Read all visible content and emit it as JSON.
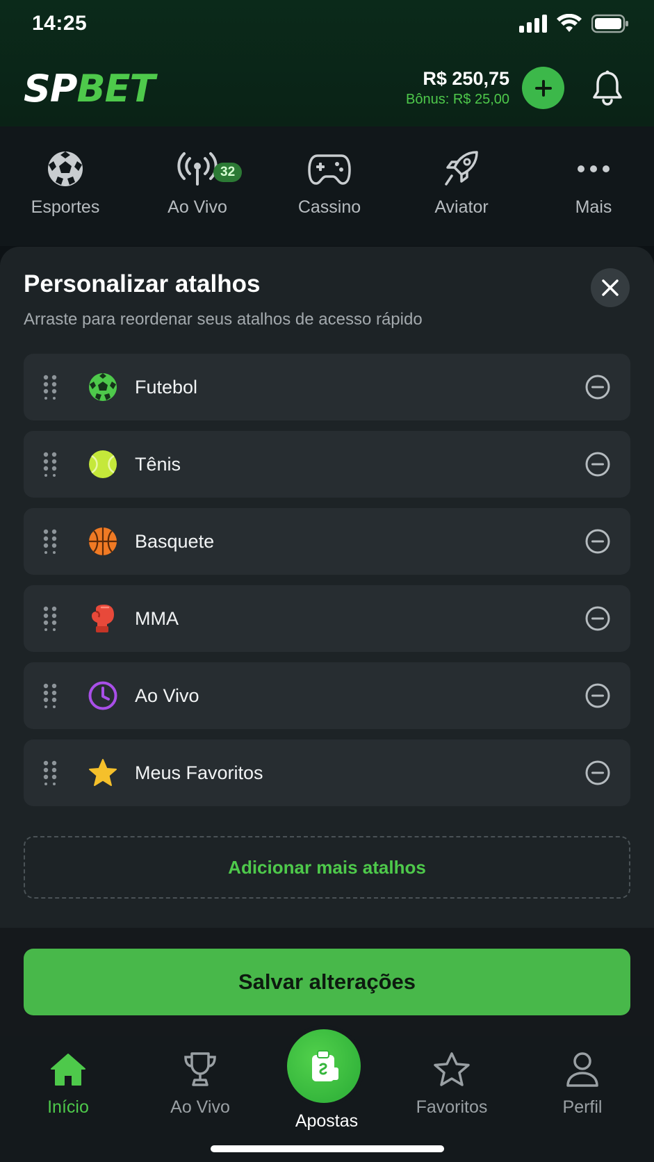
{
  "status_bar": {
    "time": "14:25"
  },
  "header": {
    "brand_part1": "SP",
    "brand_part2": "BET",
    "balance": "R$ 250,75",
    "bonus": "Bônus: R$ 25,00"
  },
  "categories": [
    {
      "label": "Esportes",
      "icon": "soccer-ball-icon"
    },
    {
      "label": "Ao Vivo",
      "icon": "broadcast-icon",
      "badge": "32"
    },
    {
      "label": "Cassino",
      "icon": "gamepad-icon"
    },
    {
      "label": "Aviator",
      "icon": "rocket-icon"
    },
    {
      "label": "Mais",
      "icon": "more-dots-icon"
    }
  ],
  "sheet": {
    "title": "Personalizar atalhos",
    "subtitle": "Arraste para reordenar seus atalhos de acesso rápido",
    "items": [
      {
        "label": "Futebol",
        "icon": "soccer-ball-icon",
        "color": "#4ec94b"
      },
      {
        "label": "Tênis",
        "icon": "tennis-ball-icon",
        "color": "#c5e83a"
      },
      {
        "label": "Basquete",
        "icon": "basketball-icon",
        "color": "#f07a24"
      },
      {
        "label": "MMA",
        "icon": "boxing-glove-icon",
        "color": "#e8493a"
      },
      {
        "label": "Ao Vivo",
        "icon": "clock-icon",
        "color": "#a94fe8"
      },
      {
        "label": "Meus Favoritos",
        "icon": "star-icon",
        "color": "#f5c02b"
      }
    ],
    "add_more": "Adicionar mais atalhos",
    "save": "Salvar alterações"
  },
  "bottom_nav": {
    "items": [
      {
        "label": "Início",
        "icon": "home-icon",
        "active": true
      },
      {
        "label": "Ao Vivo",
        "icon": "trophy-icon"
      },
      {
        "label": "Apostas",
        "icon": "betslip-icon"
      },
      {
        "label": "Favoritos",
        "icon": "star-outline-icon"
      },
      {
        "label": "Perfil",
        "icon": "user-icon"
      }
    ]
  },
  "colors": {
    "accent": "#4ec94b",
    "background": "#0d1215",
    "sheet": "#1d2326"
  }
}
